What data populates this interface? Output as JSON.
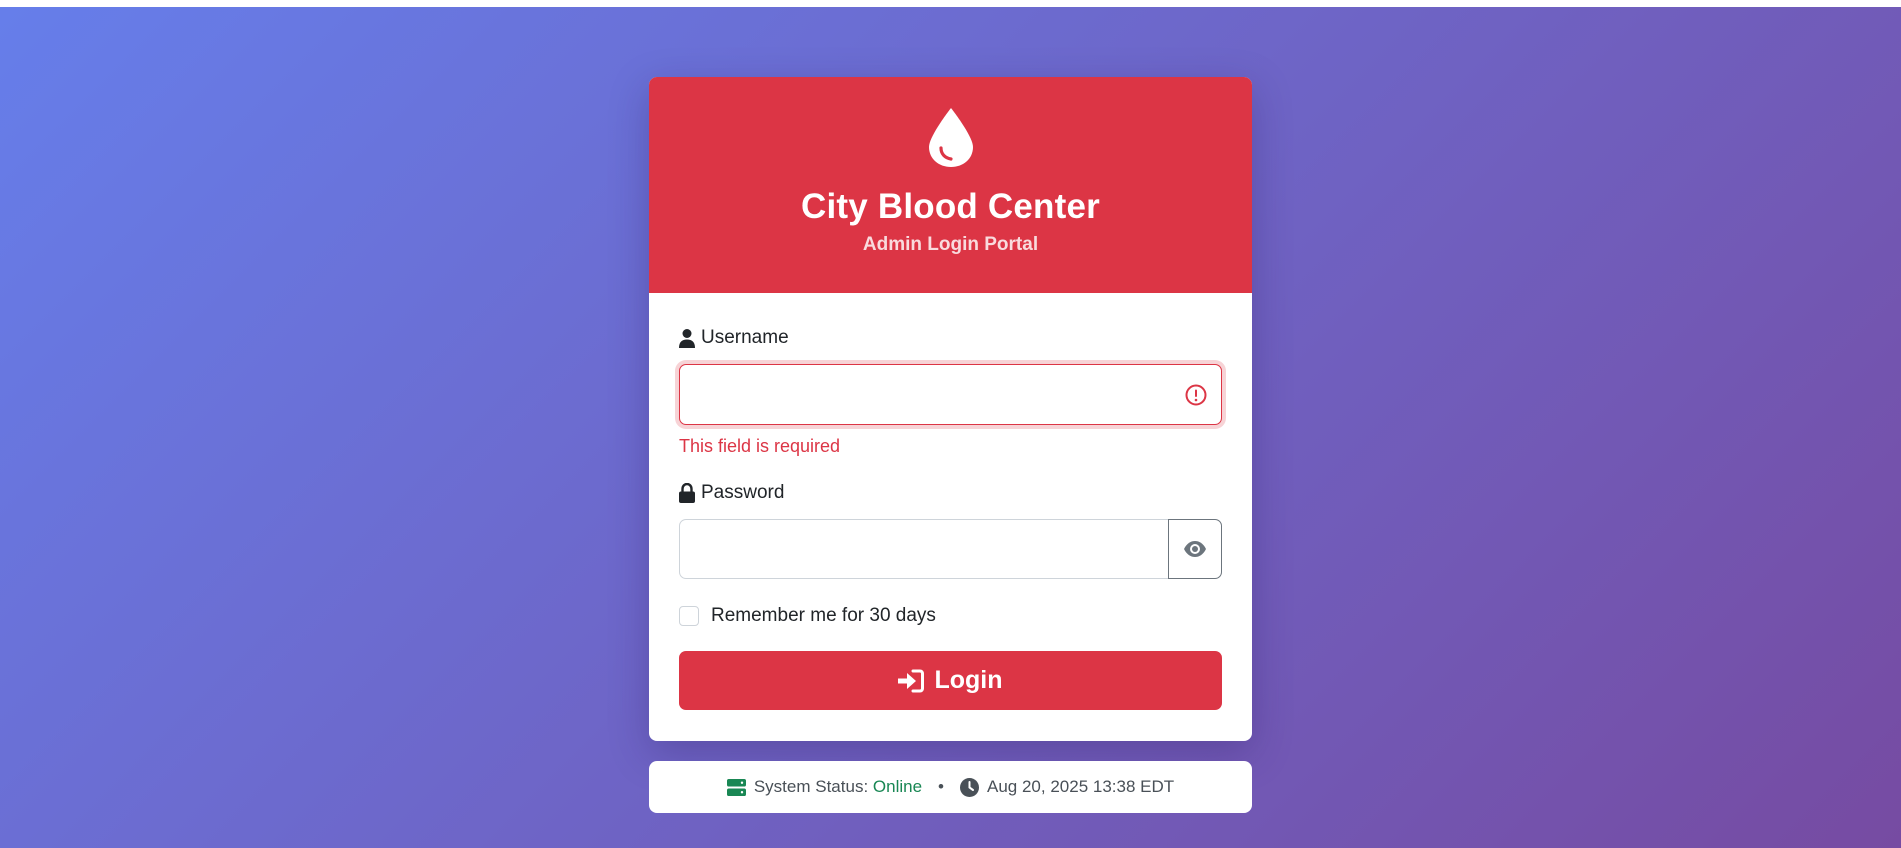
{
  "header": {
    "title": "City Blood Center",
    "subtitle": "Admin Login Portal",
    "icon": "droplet-icon",
    "accent_color": "#dc3545"
  },
  "form": {
    "username_label": "Username",
    "username_value": "",
    "username_error": "This field is required",
    "password_label": "Password",
    "password_value": "",
    "remember_label": "Remember me for 30 days",
    "remember_checked": false,
    "login_label": "Login"
  },
  "status": {
    "label": "System Status:",
    "value": "Online",
    "separator": "•",
    "datetime": "Aug 20, 2025 13:38 EDT",
    "online_color": "#198754"
  },
  "background": {
    "gradient_start": "#667eea",
    "gradient_end": "#764ba2"
  }
}
